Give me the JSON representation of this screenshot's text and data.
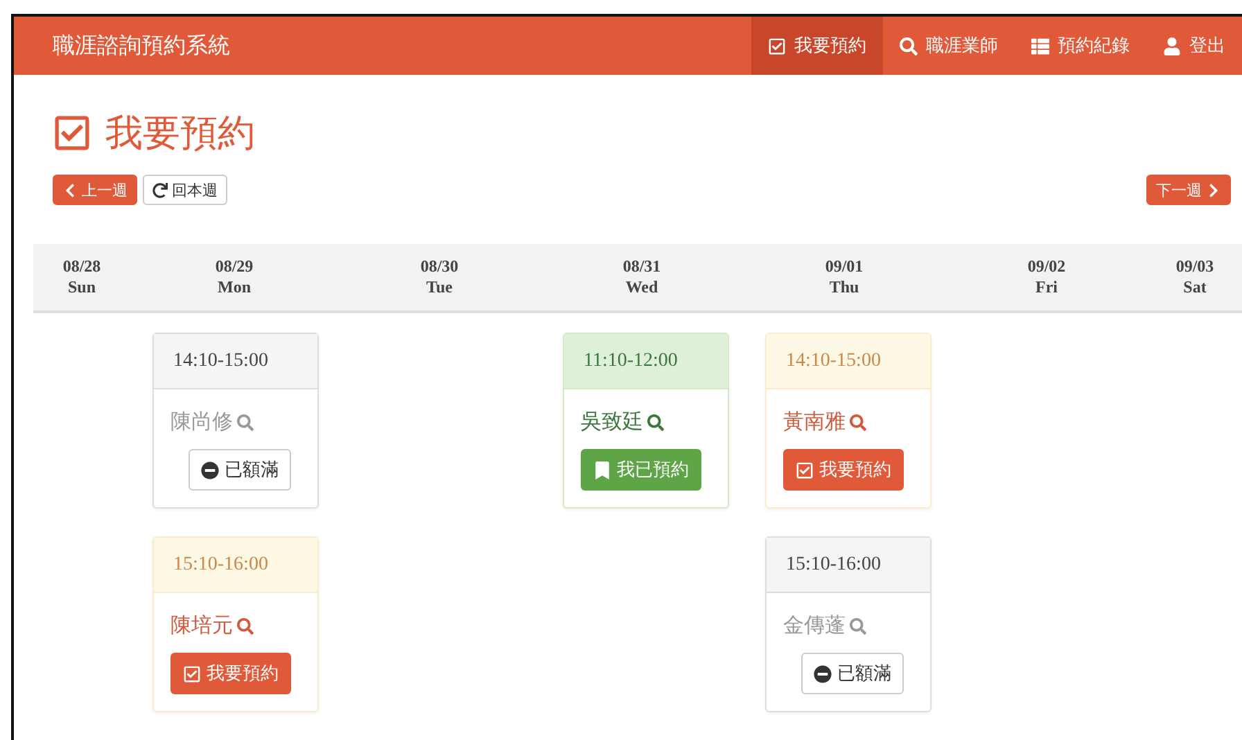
{
  "navbar": {
    "brand": "職涯諮詢預約系統",
    "items": [
      {
        "label": "我要預約",
        "kind": "check",
        "selected": true
      },
      {
        "label": "職涯業師",
        "kind": "search",
        "selected": false
      },
      {
        "label": "預約紀錄",
        "kind": "list",
        "selected": false
      },
      {
        "label": "登出",
        "kind": "user",
        "selected": false
      }
    ]
  },
  "page_title": "我要預約",
  "week_nav": {
    "prev": "上一週",
    "current": "回本週",
    "next": "下一週"
  },
  "days": [
    {
      "date": "08/28",
      "weekday": "Sun"
    },
    {
      "date": "08/29",
      "weekday": "Mon",
      "slots": [
        {
          "time": "14:10-15:00",
          "advisor": "陳尚修",
          "kind": "full",
          "action": "已額滿"
        },
        {
          "time": "15:10-16:00",
          "advisor": "陳培元",
          "kind": "open",
          "action": "我要預約"
        }
      ]
    },
    {
      "date": "08/30",
      "weekday": "Tue"
    },
    {
      "date": "08/31",
      "weekday": "Wed",
      "slots": [
        {
          "time": "11:10-12:00",
          "advisor": "吳致廷",
          "kind": "booked",
          "action": "我已預約"
        }
      ]
    },
    {
      "date": "09/01",
      "weekday": "Thu",
      "slots": [
        {
          "time": "14:10-15:00",
          "advisor": "黃南雅",
          "kind": "open",
          "action": "我要預約"
        },
        {
          "time": "15:10-16:00",
          "advisor": "金傳蓬",
          "kind": "full",
          "action": "已額滿"
        }
      ]
    },
    {
      "date": "09/02",
      "weekday": "Fri"
    },
    {
      "date": "09/03",
      "weekday": "Sat"
    }
  ]
}
